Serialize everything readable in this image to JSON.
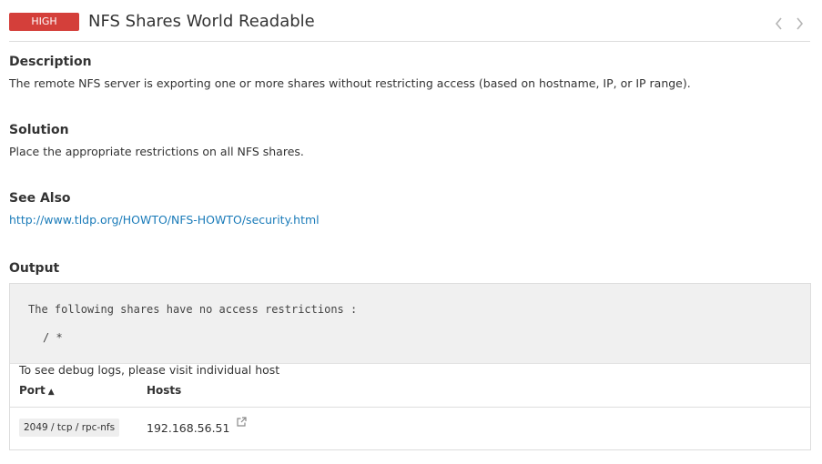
{
  "header": {
    "severity": "HIGH",
    "title": "NFS Shares World Readable",
    "colors": {
      "severity_high": "#d43f3a"
    },
    "nav": {
      "prev_icon": "chevron-left-icon",
      "next_icon": "chevron-right-icon"
    }
  },
  "description": {
    "heading": "Description",
    "text": "The remote NFS server is exporting one or more shares without restricting access (based on hostname, IP, or IP range)."
  },
  "solution": {
    "heading": "Solution",
    "text": "Place the appropriate restrictions on all NFS shares."
  },
  "see_also": {
    "heading": "See Also",
    "link": "http://www.tldp.org/HOWTO/NFS-HOWTO/security.html",
    "colors": {
      "link": "#1a7bb9"
    }
  },
  "output": {
    "heading": "Output",
    "lines": [
      "The following shares have no access restrictions :",
      "/ *"
    ],
    "debug_note": "To see debug logs, please visit individual host",
    "table": {
      "columns": [
        {
          "label": "Port",
          "sort": "ascending",
          "sort_icon": "▲"
        },
        {
          "label": "Hosts"
        }
      ],
      "rows": [
        {
          "port": "2049 / tcp / rpc-nfs",
          "host": "192.168.56.51",
          "host_icon": "external-link-icon"
        }
      ]
    }
  }
}
